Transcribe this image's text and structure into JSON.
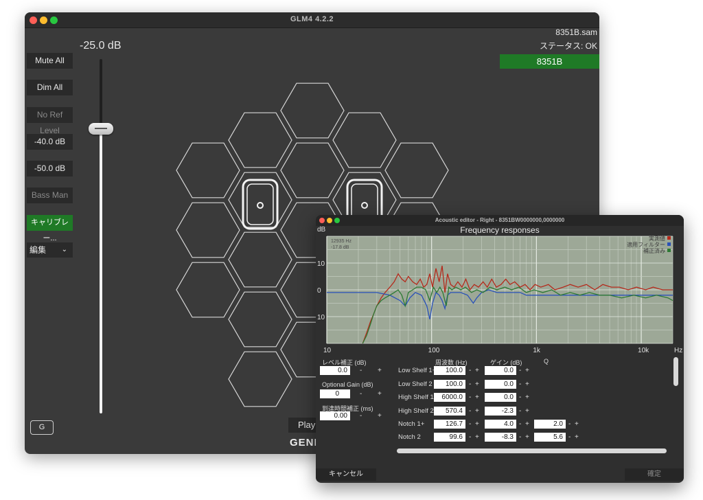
{
  "main_window": {
    "title": "GLM4  4.2.2",
    "volume_label": "-25.0 dB",
    "volume_db": -25.0,
    "file_name": "8351B.sam",
    "status_text": "ステータス: OK",
    "device_button": "8351B",
    "side_buttons": {
      "mute_all": "Mute All",
      "dim_all": "Dim All",
      "no_ref_level": "No Ref Level",
      "preset_40": "-40.0 dB",
      "preset_50": "-50.0 dB",
      "bass_man": "Bass Man",
      "calibration": "キャリブレー..."
    },
    "edit_menu": "編集",
    "edit_chevron": "⌄",
    "g_button": "G",
    "play_button": "Play",
    "brand_partial": "GENE"
  },
  "acoustic_editor": {
    "title": "Acoustic editor - Right - 8351BW0000000,0000000",
    "chart_title": "Frequency responses",
    "cancel_button": "キャンセル",
    "ok_button": "確定",
    "level_adjust_label": "レベル補正 (dB)",
    "level_adjust_value": "0.0",
    "optional_gain_label": "Optional Gain (dB)",
    "optional_gain_value": "0",
    "delay_label": "到達時間補正 (ms)",
    "delay_value": "0.00",
    "minus": "-",
    "plus": "+",
    "col_freq": "周波数 (Hz)",
    "col_gain": "ゲイン (dB)",
    "col_q": "Q",
    "filters": [
      {
        "name": "Low Shelf 1+",
        "freq": "100.0",
        "gain": "0.0",
        "q": ""
      },
      {
        "name": "Low Shelf 2",
        "freq": "100.0",
        "gain": "0.0",
        "q": ""
      },
      {
        "name": "High Shelf 1+",
        "freq": "6000.0",
        "gain": "0.0",
        "q": ""
      },
      {
        "name": "High Shelf 2",
        "freq": "570.4",
        "gain": "-2.3",
        "q": ""
      },
      {
        "name": "Notch 1+",
        "freq": "126.7",
        "gain": "4.0",
        "q": "2.0"
      },
      {
        "name": "Notch 2",
        "freq": "99.6",
        "gain": "-8.3",
        "q": "5.6"
      }
    ]
  },
  "chart_data": {
    "type": "line",
    "title": "Frequency responses",
    "xlabel": "Hz",
    "ylabel": "dB",
    "x_scale": "log",
    "xlim": [
      10,
      20000
    ],
    "ylim": [
      -20,
      20
    ],
    "x_ticks": [
      {
        "v": 10,
        "label": "10"
      },
      {
        "v": 100,
        "label": "100"
      },
      {
        "v": 1000,
        "label": "1k"
      },
      {
        "v": 10000,
        "label": "10k"
      }
    ],
    "y_ticks": [
      {
        "v": 10,
        "label": "10"
      },
      {
        "v": 0,
        "label": "0"
      },
      {
        "v": -10,
        "label": "10"
      }
    ],
    "cursor_readout": [
      "12935 Hz",
      "-17.8 dB"
    ],
    "background": "#9da897",
    "grid": true,
    "legend_position": "top-right",
    "series": [
      {
        "name": "実測値",
        "color": "#b52a1c",
        "points": [
          [
            22,
            -20
          ],
          [
            24,
            -16
          ],
          [
            26,
            -12
          ],
          [
            28,
            -9
          ],
          [
            30,
            -6
          ],
          [
            33,
            -3
          ],
          [
            36,
            -1
          ],
          [
            40,
            1
          ],
          [
            44,
            3
          ],
          [
            48,
            6
          ],
          [
            52,
            4
          ],
          [
            56,
            3
          ],
          [
            60,
            5
          ],
          [
            66,
            3
          ],
          [
            72,
            2
          ],
          [
            78,
            4
          ],
          [
            84,
            1
          ],
          [
            90,
            2
          ],
          [
            96,
            6
          ],
          [
            102,
            1
          ],
          [
            110,
            8
          ],
          [
            118,
            3
          ],
          [
            126,
            9
          ],
          [
            134,
            -1
          ],
          [
            142,
            6
          ],
          [
            152,
            2
          ],
          [
            164,
            1
          ],
          [
            178,
            3
          ],
          [
            195,
            1
          ],
          [
            212,
            4
          ],
          [
            232,
            0
          ],
          [
            255,
            2
          ],
          [
            280,
            1
          ],
          [
            310,
            3
          ],
          [
            340,
            1
          ],
          [
            375,
            4
          ],
          [
            415,
            1
          ],
          [
            460,
            2
          ],
          [
            510,
            4
          ],
          [
            560,
            2
          ],
          [
            620,
            3
          ],
          [
            700,
            1
          ],
          [
            780,
            2
          ],
          [
            870,
            0
          ],
          [
            970,
            2
          ],
          [
            1100,
            1
          ],
          [
            1300,
            2
          ],
          [
            1500,
            0
          ],
          [
            1800,
            1
          ],
          [
            2100,
            2
          ],
          [
            2500,
            1
          ],
          [
            3000,
            2
          ],
          [
            3600,
            0
          ],
          [
            4300,
            2
          ],
          [
            5200,
            1
          ],
          [
            6200,
            1
          ],
          [
            7500,
            0
          ],
          [
            9000,
            1
          ],
          [
            11000,
            0
          ],
          [
            13000,
            1
          ],
          [
            16000,
            0
          ],
          [
            20000,
            0
          ]
        ]
      },
      {
        "name": "適用フィルター",
        "color": "#2a52b8",
        "points": [
          [
            10,
            -1
          ],
          [
            20,
            -1
          ],
          [
            30,
            -1
          ],
          [
            40,
            -2
          ],
          [
            50,
            -4
          ],
          [
            56,
            -6
          ],
          [
            62,
            -3
          ],
          [
            70,
            -1
          ],
          [
            80,
            -2
          ],
          [
            90,
            -6
          ],
          [
            96,
            -11
          ],
          [
            102,
            -5
          ],
          [
            110,
            -1
          ],
          [
            118,
            -2
          ],
          [
            126,
            -4
          ],
          [
            134,
            -7
          ],
          [
            142,
            -2
          ],
          [
            152,
            -1
          ],
          [
            170,
            -1
          ],
          [
            190,
            -1
          ],
          [
            220,
            -2
          ],
          [
            250,
            -5
          ],
          [
            270,
            -3
          ],
          [
            300,
            -1
          ],
          [
            350,
            0
          ],
          [
            420,
            -1
          ],
          [
            500,
            -1
          ],
          [
            600,
            -1
          ],
          [
            700,
            -1
          ],
          [
            800,
            -2
          ],
          [
            1000,
            -2
          ],
          [
            1300,
            -2
          ],
          [
            1700,
            -2
          ],
          [
            2200,
            -2
          ],
          [
            3000,
            -2
          ],
          [
            4000,
            -2
          ],
          [
            6000,
            -2
          ],
          [
            9000,
            -2
          ],
          [
            13000,
            -2
          ],
          [
            20000,
            -2
          ]
        ]
      },
      {
        "name": "補正済み",
        "color": "#2d7a34",
        "points": [
          [
            22,
            -20
          ],
          [
            24,
            -17
          ],
          [
            26,
            -13
          ],
          [
            28,
            -9
          ],
          [
            30,
            -6
          ],
          [
            33,
            -4
          ],
          [
            36,
            -3
          ],
          [
            40,
            -2
          ],
          [
            44,
            -1
          ],
          [
            48,
            0
          ],
          [
            52,
            -2
          ],
          [
            56,
            -6
          ],
          [
            60,
            -1
          ],
          [
            66,
            0
          ],
          [
            72,
            1
          ],
          [
            80,
            1
          ],
          [
            88,
            0
          ],
          [
            96,
            -4
          ],
          [
            104,
            1
          ],
          [
            112,
            -1
          ],
          [
            120,
            1
          ],
          [
            128,
            -1
          ],
          [
            138,
            -6
          ],
          [
            146,
            1
          ],
          [
            156,
            0
          ],
          [
            170,
            1
          ],
          [
            190,
            0
          ],
          [
            210,
            1
          ],
          [
            240,
            -1
          ],
          [
            270,
            0
          ],
          [
            310,
            -1
          ],
          [
            360,
            1
          ],
          [
            420,
            0
          ],
          [
            500,
            1
          ],
          [
            580,
            0
          ],
          [
            680,
            1
          ],
          [
            800,
            -1
          ],
          [
            950,
            0
          ],
          [
            1150,
            -1
          ],
          [
            1400,
            0
          ],
          [
            1700,
            -2
          ],
          [
            2100,
            -1
          ],
          [
            2600,
            -2
          ],
          [
            3200,
            -1
          ],
          [
            4000,
            -2
          ],
          [
            5000,
            -2
          ],
          [
            6500,
            -3
          ],
          [
            8500,
            -2
          ],
          [
            11000,
            -3
          ],
          [
            14000,
            -2
          ],
          [
            18000,
            -3
          ],
          [
            20000,
            -4
          ]
        ]
      }
    ]
  }
}
